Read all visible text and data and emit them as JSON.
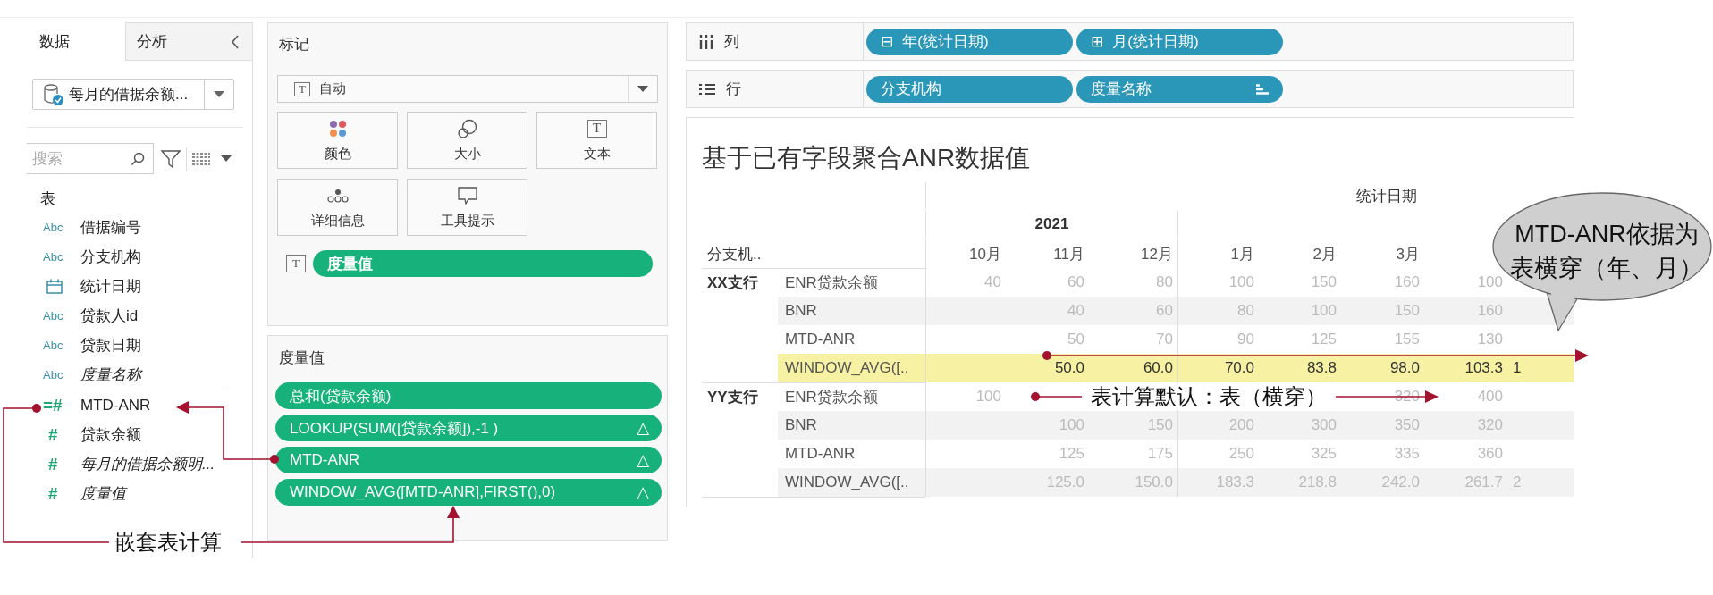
{
  "data_pane": {
    "tabs": [
      {
        "label": "数据",
        "selected": true
      },
      {
        "label": "分析",
        "selected": false
      }
    ],
    "datasource": {
      "label": "每月的借据余额..."
    },
    "search": {
      "placeholder": "搜索"
    },
    "section": "表",
    "fields": [
      {
        "kind": "dimension",
        "icon": "Abc",
        "name": "借据编号",
        "italic": false
      },
      {
        "kind": "dimension",
        "icon": "Abc",
        "name": "分支机构",
        "italic": false
      },
      {
        "kind": "date",
        "name": "统计日期",
        "italic": false
      },
      {
        "kind": "dimension",
        "icon": "Abc",
        "name": "贷款人id",
        "italic": false
      },
      {
        "kind": "dimension",
        "icon": "Abc",
        "name": "贷款日期",
        "italic": false
      },
      {
        "kind": "dimension",
        "icon": "Abc",
        "name": "度量名称",
        "italic": true
      },
      {
        "kind": "measure",
        "icon": "=#",
        "name": "MTD-ANR",
        "italic": false
      },
      {
        "kind": "measure",
        "icon": "#",
        "name": "贷款余额",
        "italic": false
      },
      {
        "kind": "measure",
        "icon": "#",
        "name": "每月的借据余额明...",
        "italic": true
      },
      {
        "kind": "measure",
        "icon": "#",
        "name": "度量值",
        "italic": true
      }
    ]
  },
  "marks": {
    "title": "标记",
    "mark_type": {
      "icon": "T",
      "label": "自动"
    },
    "buttons": [
      {
        "kind": "color",
        "label": "颜色"
      },
      {
        "kind": "size",
        "label": "大小"
      },
      {
        "kind": "text",
        "icon": "T",
        "label": "文本"
      },
      {
        "kind": "detail",
        "label": "详细信息"
      },
      {
        "kind": "tooltip",
        "label": "工具提示"
      }
    ],
    "mark_fields": [
      {
        "icon": "T",
        "label": "度量值"
      }
    ]
  },
  "measure_values": {
    "title": "度量值",
    "pills": [
      {
        "label": "总和(贷款余额)"
      },
      {
        "label": "LOOKUP(SUM([贷款余额]),-1 )",
        "badge": "△"
      },
      {
        "label": "MTD-ANR",
        "badge": "△"
      },
      {
        "label": "WINDOW_AVG([MTD-ANR],FIRST(),0)",
        "badge": "△"
      }
    ]
  },
  "shelves": [
    {
      "kind": "columns",
      "label": "列",
      "pills": [
        {
          "icon": "⊟",
          "label": "年(统计日期)"
        },
        {
          "icon": "⊞",
          "label": "月(统计日期)"
        }
      ]
    },
    {
      "kind": "rows",
      "label": "行",
      "pills": [
        {
          "label": "分支机构",
          "sorted": false
        },
        {
          "label": "度量名称",
          "sorted": true
        }
      ]
    }
  ],
  "viz": {
    "title": "基于已有字段聚合ANR数据值",
    "header": "统计日期",
    "row_header": "分支机..",
    "year_groups": [
      {
        "label": "2021",
        "columns": [
          "10月",
          "11月",
          "12月"
        ]
      },
      {
        "columns": [
          "1月",
          "2月",
          "3月"
        ]
      }
    ],
    "groups": [
      {
        "label": "XX支行",
        "rows": [
          {
            "measure": "ENR贷款余额",
            "highlighted": false,
            "cells": [
              {
                "kind": "value",
                "text": "40"
              },
              {
                "kind": "value",
                "text": "60"
              },
              {
                "kind": "value",
                "text": "80"
              },
              {
                "kind": "value",
                "text": "100"
              },
              {
                "kind": "value",
                "text": "150"
              },
              {
                "kind": "value",
                "text": "160"
              },
              {
                "kind": "value",
                "text": "100"
              },
              {
                "kind": "blank"
              }
            ]
          },
          {
            "measure": "BNR",
            "highlighted": false,
            "cells": [
              {
                "kind": "blank"
              },
              {
                "kind": "value",
                "text": "40"
              },
              {
                "kind": "value",
                "text": "60"
              },
              {
                "kind": "value",
                "text": "80"
              },
              {
                "kind": "value",
                "text": "100"
              },
              {
                "kind": "value",
                "text": "150"
              },
              {
                "kind": "value",
                "text": "160"
              },
              {
                "kind": "blank"
              }
            ]
          },
          {
            "measure": "MTD-ANR",
            "highlighted": false,
            "cells": [
              {
                "kind": "blank"
              },
              {
                "kind": "value",
                "text": "50"
              },
              {
                "kind": "value",
                "text": "70"
              },
              {
                "kind": "value",
                "text": "90"
              },
              {
                "kind": "value",
                "text": "125"
              },
              {
                "kind": "value",
                "text": "155"
              },
              {
                "kind": "value",
                "text": "130"
              },
              {
                "kind": "blank"
              }
            ]
          },
          {
            "measure": "WINDOW_AVG([..",
            "highlighted": true,
            "cells": [
              {
                "kind": "blank"
              },
              {
                "kind": "value",
                "text": "50.0"
              },
              {
                "kind": "value",
                "text": "60.0"
              },
              {
                "kind": "value",
                "text": "70.0"
              },
              {
                "kind": "value",
                "text": "83.8"
              },
              {
                "kind": "value",
                "text": "98.0"
              },
              {
                "kind": "value",
                "text": "103.3"
              },
              {
                "kind": "value",
                "text": "1"
              }
            ]
          }
        ]
      },
      {
        "label": "YY支行",
        "rows": [
          {
            "measure": "ENR贷款余额",
            "highlighted": false,
            "cells": [
              {
                "kind": "value",
                "text": "100"
              },
              {
                "kind": "blank"
              },
              {
                "kind": "blank"
              },
              {
                "kind": "blank"
              },
              {
                "kind": "blank"
              },
              {
                "kind": "value",
                "text": "320"
              },
              {
                "kind": "value",
                "text": "400"
              },
              {
                "kind": "blank"
              }
            ]
          },
          {
            "measure": "BNR",
            "highlighted": false,
            "cells": [
              {
                "kind": "blank"
              },
              {
                "kind": "value",
                "text": "100"
              },
              {
                "kind": "value",
                "text": "150"
              },
              {
                "kind": "value",
                "text": "200"
              },
              {
                "kind": "value",
                "text": "300"
              },
              {
                "kind": "value",
                "text": "350"
              },
              {
                "kind": "value",
                "text": "320"
              },
              {
                "kind": "blank"
              }
            ]
          },
          {
            "measure": "MTD-ANR",
            "highlighted": false,
            "cells": [
              {
                "kind": "blank"
              },
              {
                "kind": "value",
                "text": "125"
              },
              {
                "kind": "value",
                "text": "175"
              },
              {
                "kind": "value",
                "text": "250"
              },
              {
                "kind": "value",
                "text": "325"
              },
              {
                "kind": "value",
                "text": "335"
              },
              {
                "kind": "value",
                "text": "360"
              },
              {
                "kind": "blank"
              }
            ]
          },
          {
            "measure": "WINDOW_AVG([..",
            "highlighted": false,
            "cells": [
              {
                "kind": "blank"
              },
              {
                "kind": "value",
                "text": "125.0"
              },
              {
                "kind": "value",
                "text": "150.0"
              },
              {
                "kind": "value",
                "text": "183.3"
              },
              {
                "kind": "value",
                "text": "218.8"
              },
              {
                "kind": "value",
                "text": "242.0"
              },
              {
                "kind": "value",
                "text": "261.7"
              },
              {
                "kind": "value",
                "text": "2"
              }
            ]
          }
        ]
      }
    ]
  },
  "annotations": {
    "callout": {
      "lines": [
        "MTD-ANR依据为",
        "表横穿（年、月）"
      ]
    },
    "nested_label": "嵌套表计算",
    "default_label": "表计算默认：表（横穿）"
  }
}
